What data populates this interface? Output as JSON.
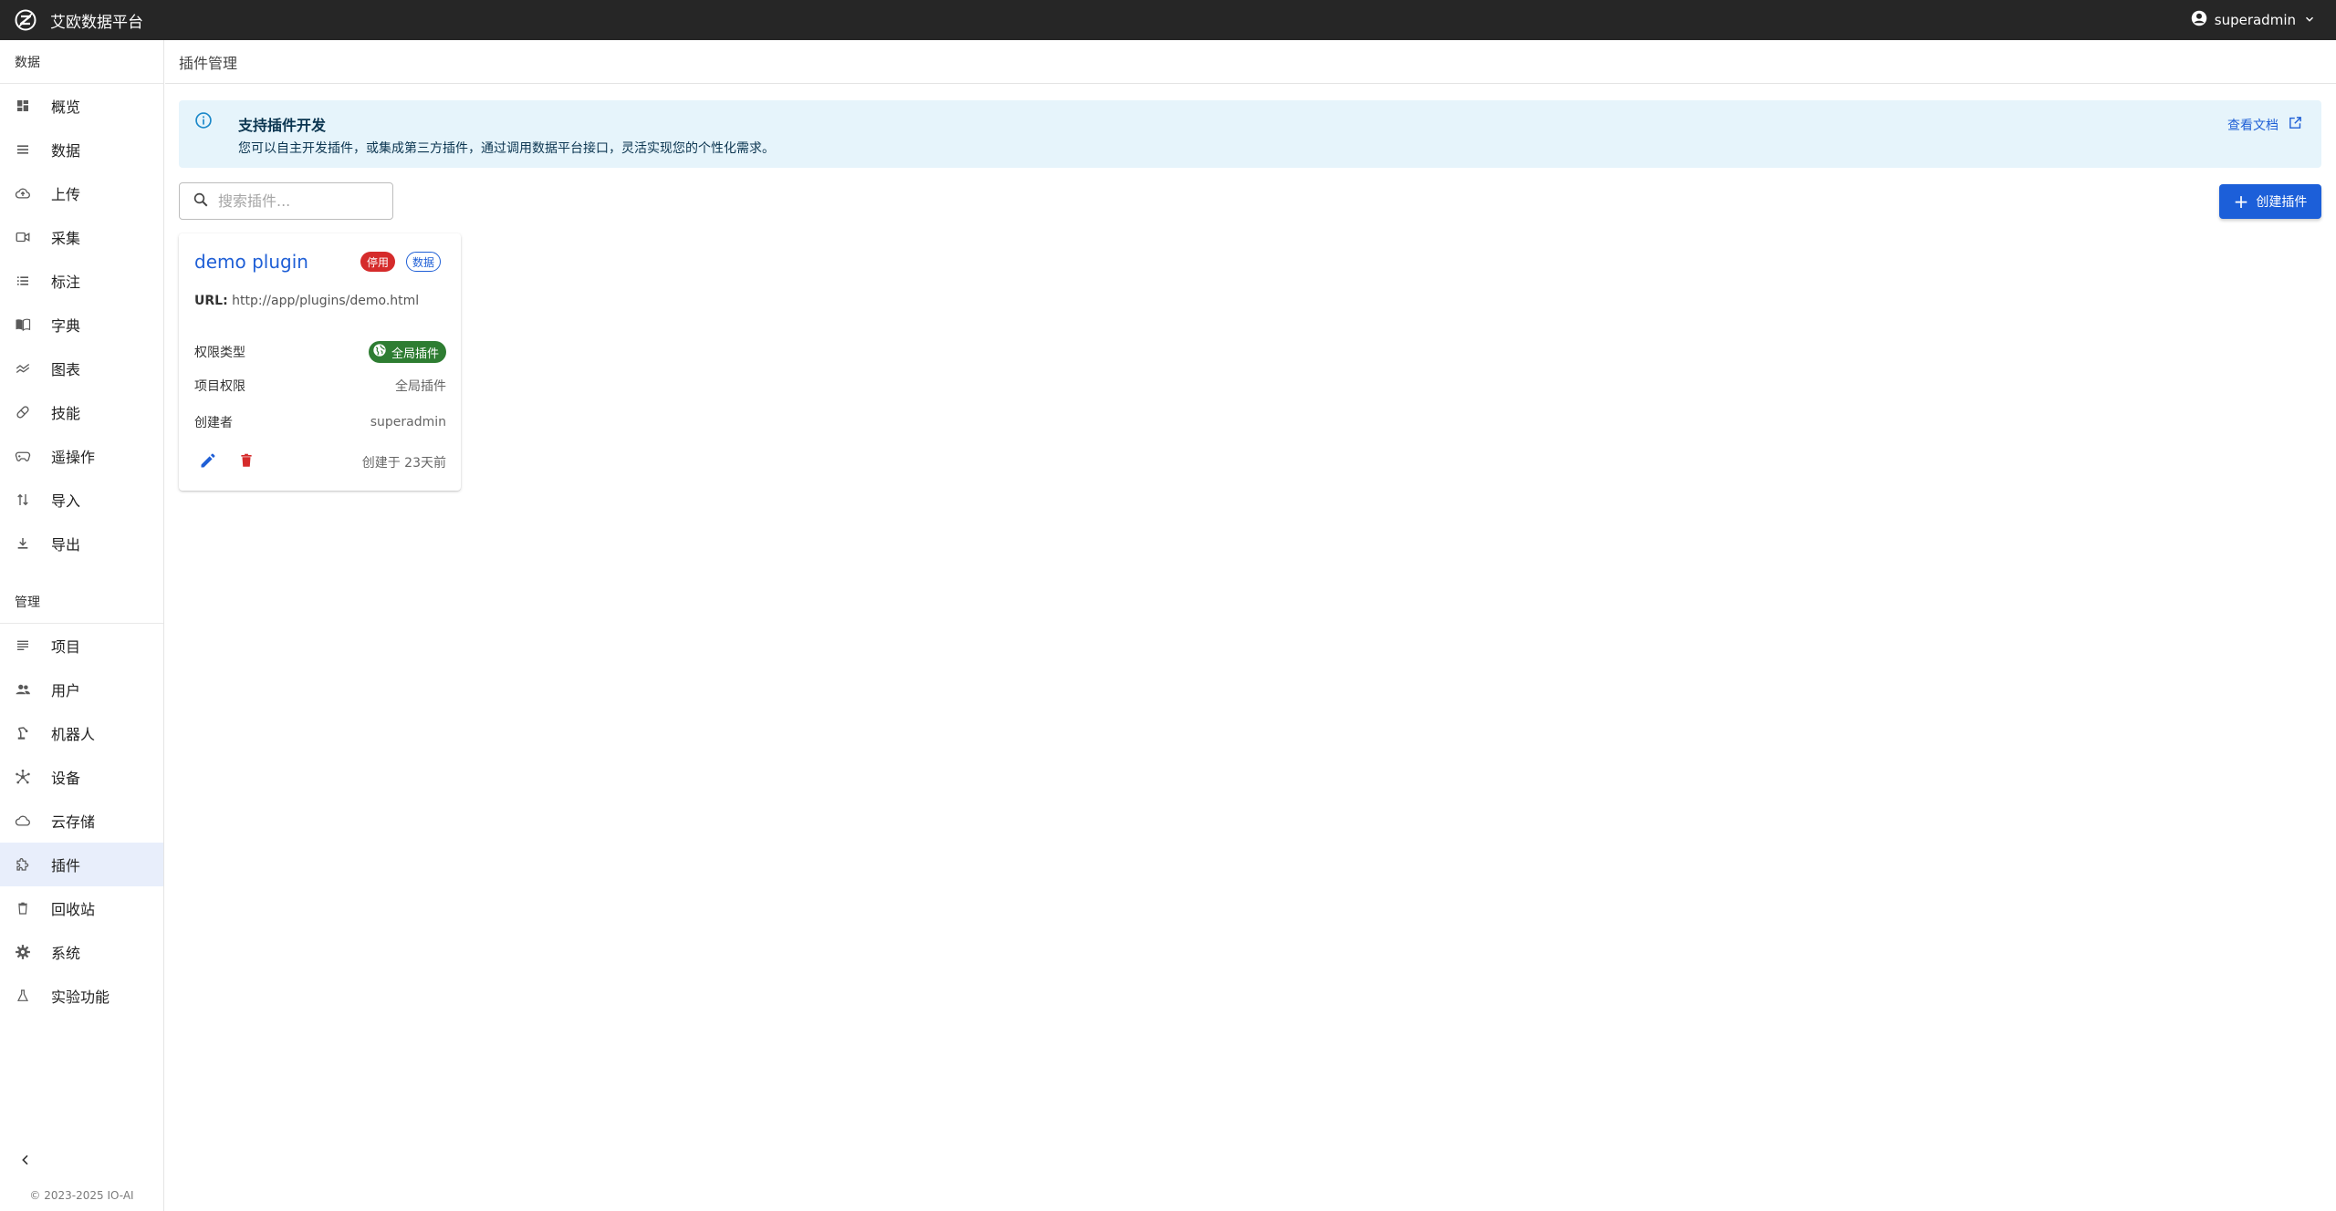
{
  "app": {
    "title": "艾欧数据平台",
    "user": "superadmin"
  },
  "sidebar": {
    "data_section": "数据",
    "data_items": [
      {
        "label": "概览",
        "icon": "dashboard-icon"
      },
      {
        "label": "数据",
        "icon": "list-icon"
      },
      {
        "label": "上传",
        "icon": "cloud-upload-icon"
      },
      {
        "label": "采集",
        "icon": "video-camera-icon"
      },
      {
        "label": "标注",
        "icon": "checklist-icon"
      },
      {
        "label": "字典",
        "icon": "book-icon"
      },
      {
        "label": "图表",
        "icon": "chart-icon"
      },
      {
        "label": "技能",
        "icon": "pill-icon"
      },
      {
        "label": "遥操作",
        "icon": "gamepad-icon"
      },
      {
        "label": "导入",
        "icon": "import-icon"
      },
      {
        "label": "导出",
        "icon": "download-icon"
      }
    ],
    "admin_section": "管理",
    "admin_items": [
      {
        "label": "项目",
        "icon": "project-icon"
      },
      {
        "label": "用户",
        "icon": "users-icon"
      },
      {
        "label": "机器人",
        "icon": "robot-arm-icon"
      },
      {
        "label": "设备",
        "icon": "hub-icon"
      },
      {
        "label": "云存储",
        "icon": "cloud-icon"
      },
      {
        "label": "插件",
        "icon": "extension-icon",
        "active": true
      },
      {
        "label": "回收站",
        "icon": "trash-icon"
      },
      {
        "label": "系统",
        "icon": "gear-icon"
      },
      {
        "label": "实验功能",
        "icon": "flask-icon"
      }
    ],
    "copyright": "© 2023-2025 IO-AI"
  },
  "page": {
    "title": "插件管理",
    "alert": {
      "title": "支持插件开发",
      "text": "您可以自主开发插件，或集成第三方插件，通过调用数据平台接口，灵活实现您的个性化需求。",
      "link": "查看文档"
    },
    "search": {
      "placeholder": "搜索插件..."
    },
    "create_button": "创建插件"
  },
  "plugins": [
    {
      "name": "demo plugin",
      "status": "停用",
      "category": "数据",
      "url_label": "URL:",
      "url": "http://app/plugins/demo.html",
      "permission_type_label": "权限类型",
      "permission_type": "全局插件",
      "project_permission_label": "项目权限",
      "project_permission": "全局插件",
      "creator_label": "创建者",
      "creator": "superadmin",
      "created": "创建于 23天前"
    }
  ],
  "colors": {
    "topbar": "#262626",
    "accent": "#1c5fd9",
    "danger": "#d52b2b",
    "success": "#2e7d32",
    "alert_bg": "#e6f4fb",
    "active_nav": "#e8eefb"
  }
}
